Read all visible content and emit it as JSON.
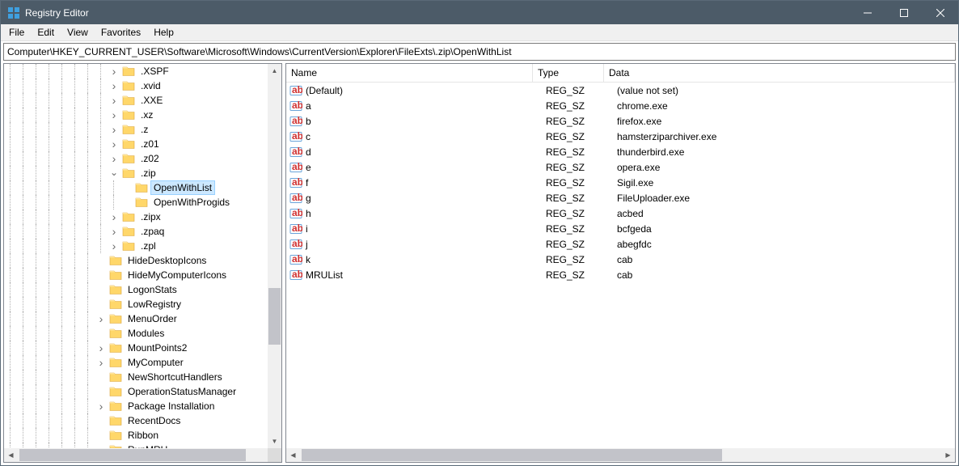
{
  "window": {
    "title": "Registry Editor"
  },
  "menu": {
    "file": "File",
    "edit": "Edit",
    "view": "View",
    "favorites": "Favorites",
    "help": "Help"
  },
  "address": "Computer\\HKEY_CURRENT_USER\\Software\\Microsoft\\Windows\\CurrentVersion\\Explorer\\FileExts\\.zip\\OpenWithList",
  "tree": [
    {
      "indent": 9,
      "expander": "closed",
      "label": ".XSPF"
    },
    {
      "indent": 9,
      "expander": "closed",
      "label": ".xvid"
    },
    {
      "indent": 9,
      "expander": "closed",
      "label": ".XXE"
    },
    {
      "indent": 9,
      "expander": "closed",
      "label": ".xz"
    },
    {
      "indent": 9,
      "expander": "closed",
      "label": ".z"
    },
    {
      "indent": 9,
      "expander": "closed",
      "label": ".z01"
    },
    {
      "indent": 9,
      "expander": "closed",
      "label": ".z02"
    },
    {
      "indent": 9,
      "expander": "open",
      "label": ".zip"
    },
    {
      "indent": 10,
      "expander": "none",
      "label": "OpenWithList",
      "selected": true
    },
    {
      "indent": 10,
      "expander": "none",
      "label": "OpenWithProgids"
    },
    {
      "indent": 9,
      "expander": "closed",
      "label": ".zipx"
    },
    {
      "indent": 9,
      "expander": "closed",
      "label": ".zpaq"
    },
    {
      "indent": 9,
      "expander": "closed",
      "label": ".zpl"
    },
    {
      "indent": 8,
      "expander": "none",
      "label": "HideDesktopIcons"
    },
    {
      "indent": 8,
      "expander": "none",
      "label": "HideMyComputerIcons"
    },
    {
      "indent": 8,
      "expander": "none",
      "label": "LogonStats"
    },
    {
      "indent": 8,
      "expander": "none",
      "label": "LowRegistry"
    },
    {
      "indent": 8,
      "expander": "closed",
      "label": "MenuOrder"
    },
    {
      "indent": 8,
      "expander": "none",
      "label": "Modules"
    },
    {
      "indent": 8,
      "expander": "closed",
      "label": "MountPoints2"
    },
    {
      "indent": 8,
      "expander": "closed",
      "label": "MyComputer"
    },
    {
      "indent": 8,
      "expander": "none",
      "label": "NewShortcutHandlers"
    },
    {
      "indent": 8,
      "expander": "none",
      "label": "OperationStatusManager"
    },
    {
      "indent": 8,
      "expander": "closed",
      "label": "Package Installation"
    },
    {
      "indent": 8,
      "expander": "none",
      "label": "RecentDocs"
    },
    {
      "indent": 8,
      "expander": "none",
      "label": "Ribbon"
    },
    {
      "indent": 8,
      "expander": "closed",
      "label": "RunMRU"
    }
  ],
  "list": {
    "headers": {
      "name": "Name",
      "type": "Type",
      "data": "Data"
    },
    "rows": [
      {
        "name": "(Default)",
        "type": "REG_SZ",
        "data": "(value not set)"
      },
      {
        "name": "a",
        "type": "REG_SZ",
        "data": "chrome.exe"
      },
      {
        "name": "b",
        "type": "REG_SZ",
        "data": "firefox.exe"
      },
      {
        "name": "c",
        "type": "REG_SZ",
        "data": "hamsterziparchiver.exe"
      },
      {
        "name": "d",
        "type": "REG_SZ",
        "data": "thunderbird.exe"
      },
      {
        "name": "e",
        "type": "REG_SZ",
        "data": "opera.exe"
      },
      {
        "name": "f",
        "type": "REG_SZ",
        "data": "Sigil.exe"
      },
      {
        "name": "g",
        "type": "REG_SZ",
        "data": "FileUploader.exe"
      },
      {
        "name": "h",
        "type": "REG_SZ",
        "data": "acbed"
      },
      {
        "name": "i",
        "type": "REG_SZ",
        "data": "bcfgeda"
      },
      {
        "name": "j",
        "type": "REG_SZ",
        "data": "abegfdc"
      },
      {
        "name": "k",
        "type": "REG_SZ",
        "data": "cab"
      },
      {
        "name": "MRUList",
        "type": "REG_SZ",
        "data": "cab"
      }
    ]
  }
}
